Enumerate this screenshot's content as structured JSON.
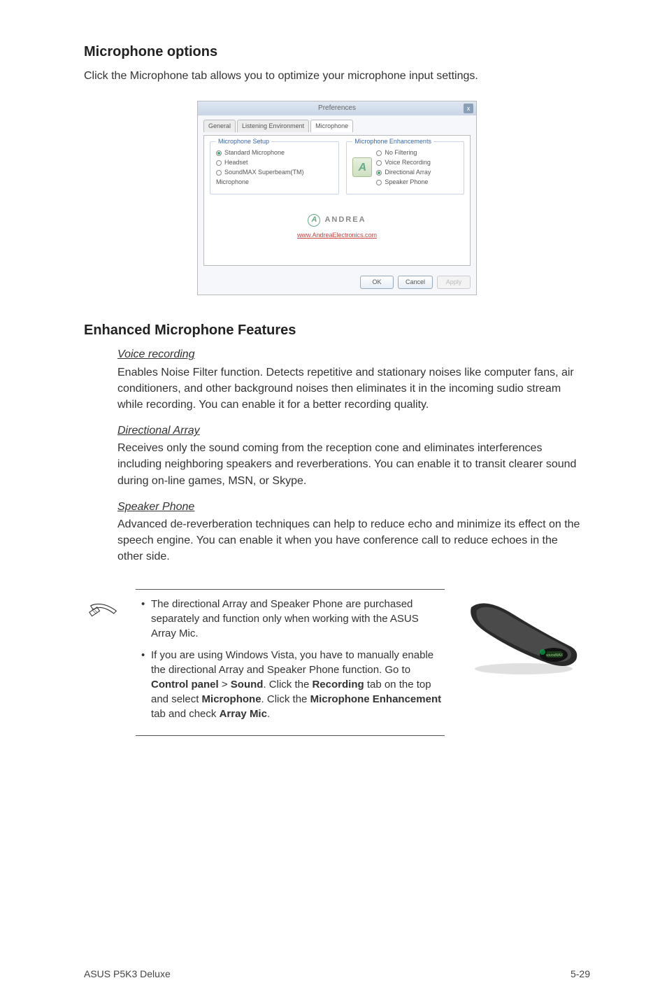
{
  "section1": {
    "heading": "Microphone options",
    "intro": "Click the Microphone tab allows you to optimize your microphone input settings."
  },
  "dialog": {
    "title": "Preferences",
    "close_glyph": "x",
    "tabs": {
      "t1": "General",
      "t2": "Listening Environment",
      "t3": "Microphone"
    },
    "setup_legend": "Microphone Setup",
    "setup_opts": {
      "o1": "Standard Microphone",
      "o2": "Headset",
      "o3": "SoundMAX Superbeam(TM) Microphone"
    },
    "enh_legend": "Microphone Enhancements",
    "enh_opts": {
      "o1": "No Filtering",
      "o2": "Voice Recording",
      "o3": "Directional Array",
      "o4": "Speaker Phone"
    },
    "andrea_brand": "ANDREA",
    "andrea_url": "www.AndreaElectronics.com",
    "buttons": {
      "ok": "OK",
      "cancel": "Cancel",
      "apply": "Apply"
    }
  },
  "section2": {
    "heading": "Enhanced Microphone Features",
    "voice": {
      "title": "Voice recording",
      "body": "Enables Noise Filter function. Detects repetitive and stationary noises like computer fans, air conditioners, and other background noises then eliminates it in the incoming sudio stream while recording. You can enable it for a better recording quality."
    },
    "dir": {
      "title": "Directional Array",
      "body": "Receives only the sound coming from the reception cone and eliminates interferences including neighboring speakers and reverberations. You can enable it to transit clearer sound during on-line games, MSN, or Skype."
    },
    "spk": {
      "title": "Speaker Phone",
      "body": "Advanced de-reverberation techniques can help to reduce echo and minimize its effect on the speech engine. You can enable it when you have conference call to reduce echoes in the other side."
    }
  },
  "note": {
    "li1": "The directional Array and Speaker Phone are purchased separately and function only when working with the ASUS Array Mic.",
    "li2_pre": "If you are using Windows Vista, you have to manually enable the directional Array and Speaker Phone function. Go to ",
    "li2_b1": "Control panel",
    "li2_gt": " > ",
    "li2_b2": "Sound",
    "li2_mid1": ". Click the ",
    "li2_b3": "Recording",
    "li2_mid2": " tab on the top and select ",
    "li2_b4": "Microphone",
    "li2_mid3": ". Click the ",
    "li2_b5": "Microphone Enhancement",
    "li2_mid4": " tab and check ",
    "li2_b6": "Array Mic",
    "li2_end": "."
  },
  "footer": {
    "left": "ASUS P5K3 Deluxe",
    "right": "5-29"
  }
}
